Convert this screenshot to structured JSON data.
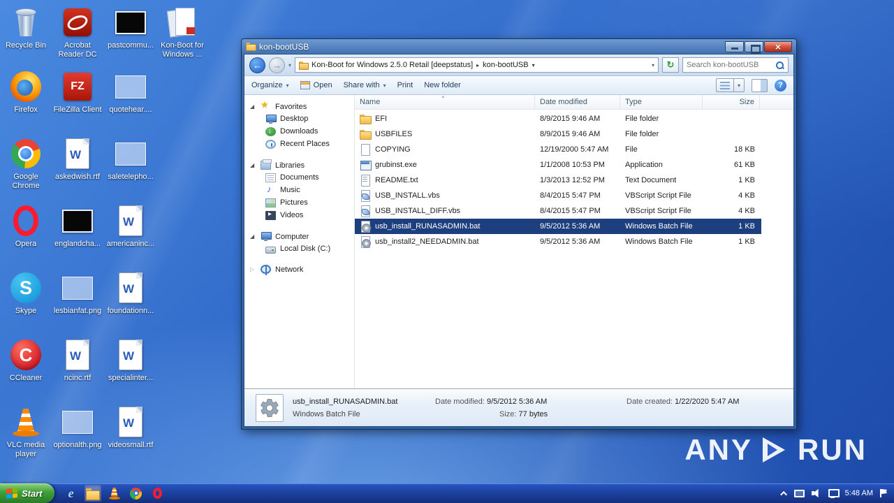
{
  "desktop": {
    "icons": [
      {
        "label": "Recycle Bin",
        "kind": "recycle-bin"
      },
      {
        "label": "Firefox",
        "kind": "firefox"
      },
      {
        "label": "Google Chrome",
        "kind": "chrome"
      },
      {
        "label": "Opera",
        "kind": "opera"
      },
      {
        "label": "Skype",
        "kind": "skype"
      },
      {
        "label": "CCleaner",
        "kind": "ccleaner"
      },
      {
        "label": "VLC media player",
        "kind": "vlc"
      },
      {
        "label": "Acrobat Reader DC",
        "kind": "acrobat"
      },
      {
        "label": "FileZilla Client",
        "kind": "filezilla"
      },
      {
        "label": "askedwish.rtf",
        "kind": "word-doc"
      },
      {
        "label": "englandcha...",
        "kind": "image-dark"
      },
      {
        "label": "lesbianfat.png",
        "kind": "image-light"
      },
      {
        "label": "ncinc.rtf",
        "kind": "word-doc"
      },
      {
        "label": "optionalth.png",
        "kind": "image-light"
      },
      {
        "label": "pastcommu...",
        "kind": "image-dark"
      },
      {
        "label": "quotehear....",
        "kind": "image-light"
      },
      {
        "label": "saletelepho...",
        "kind": "image-light"
      },
      {
        "label": "americaninc...",
        "kind": "word-doc"
      },
      {
        "label": "foundationn...",
        "kind": "word-doc"
      },
      {
        "label": "specialinter...",
        "kind": "word-doc"
      },
      {
        "label": "videosmall.rtf",
        "kind": "word-doc"
      },
      {
        "label": "Kon-Boot for Windows ...",
        "kind": "document-stack"
      }
    ]
  },
  "explorer": {
    "title": "kon-bootUSB",
    "breadcrumb": {
      "root": "Kon-Boot for Windows 2.5.0 Retail [deepstatus]",
      "current": "kon-bootUSB"
    },
    "search": {
      "placeholder": "Search kon-bootUSB"
    },
    "toolbar": {
      "organize": "Organize",
      "open": "Open",
      "share": "Share with",
      "print": "Print",
      "new_folder": "New folder"
    },
    "nav": {
      "favorites": {
        "label": "Favorites",
        "items": [
          "Desktop",
          "Downloads",
          "Recent Places"
        ]
      },
      "libraries": {
        "label": "Libraries",
        "items": [
          "Documents",
          "Music",
          "Pictures",
          "Videos"
        ]
      },
      "computer": {
        "label": "Computer",
        "items": [
          "Local Disk (C:)"
        ]
      },
      "network": {
        "label": "Network"
      }
    },
    "columns": [
      "Name",
      "Date modified",
      "Type",
      "Size"
    ],
    "files": [
      {
        "name": "EFI",
        "modified": "8/9/2015 9:46 AM",
        "type": "File folder",
        "size": "",
        "icon": "folder",
        "selected": false
      },
      {
        "name": "USBFILES",
        "modified": "8/9/2015 9:46 AM",
        "type": "File folder",
        "size": "",
        "icon": "folder",
        "selected": false
      },
      {
        "name": "COPYING",
        "modified": "12/19/2000 5:47 AM",
        "type": "File",
        "size": "18 KB",
        "icon": "file",
        "selected": false
      },
      {
        "name": "grubinst.exe",
        "modified": "1/1/2008 10:53 PM",
        "type": "Application",
        "size": "61 KB",
        "icon": "application",
        "selected": false
      },
      {
        "name": "README.txt",
        "modified": "1/3/2013 12:52 PM",
        "type": "Text Document",
        "size": "1 KB",
        "icon": "text",
        "selected": false
      },
      {
        "name": "USB_INSTALL.vbs",
        "modified": "8/4/2015 5:47 PM",
        "type": "VBScript Script File",
        "size": "4 KB",
        "icon": "vbscript",
        "selected": false
      },
      {
        "name": "USB_INSTALL_DIFF.vbs",
        "modified": "8/4/2015 5:47 PM",
        "type": "VBScript Script File",
        "size": "4 KB",
        "icon": "vbscript",
        "selected": false
      },
      {
        "name": "usb_install_RUNASADMIN.bat",
        "modified": "9/5/2012 5:36 AM",
        "type": "Windows Batch File",
        "size": "1 KB",
        "icon": "batch",
        "selected": true
      },
      {
        "name": "usb_install2_NEEDADMIN.bat",
        "modified": "9/5/2012 5:36 AM",
        "type": "Windows Batch File",
        "size": "1 KB",
        "icon": "batch",
        "selected": false
      }
    ],
    "details": {
      "name": "usb_install_RUNASADMIN.bat",
      "type": "Windows Batch File",
      "modified_label": "Date modified:",
      "modified": "9/5/2012 5:36 AM",
      "size_label": "Size:",
      "size": "77 bytes",
      "created_label": "Date created:",
      "created": "1/22/2020 5:47 AM"
    }
  },
  "taskbar": {
    "start_label": "Start",
    "clock": "5:48 AM"
  },
  "watermark": {
    "left": "ANY",
    "right": "RUN"
  }
}
